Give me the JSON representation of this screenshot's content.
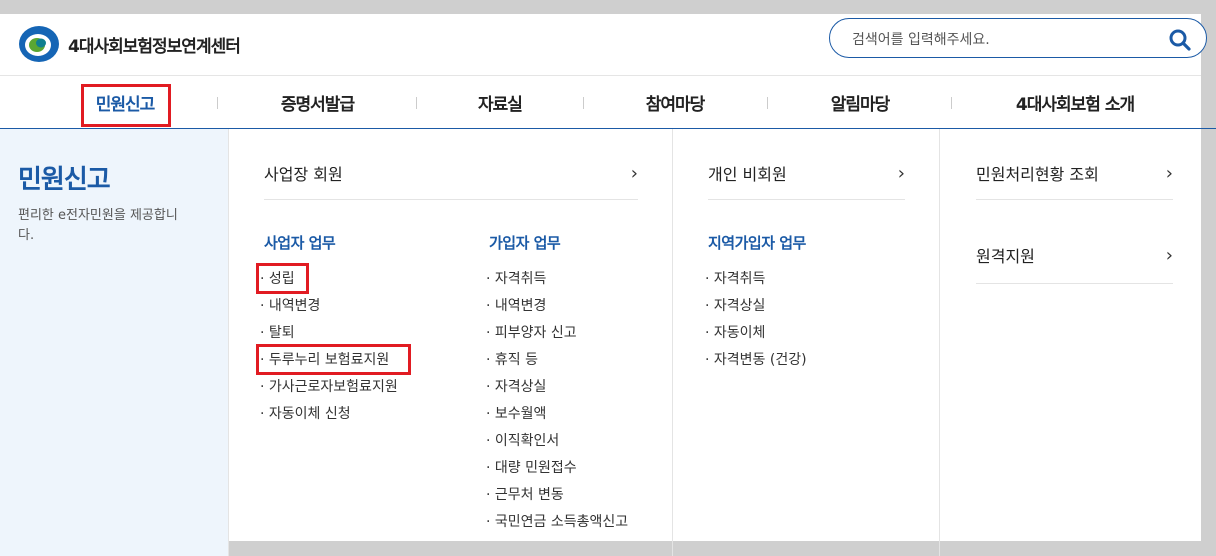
{
  "header": {
    "site_name": "4대사회보험정보연계센터",
    "search_placeholder": "검색어를 입력해주세요."
  },
  "gnb": [
    "민원신고",
    "증명서발급",
    "자료실",
    "참여마당",
    "알림마당",
    "4대사회보험 소개"
  ],
  "side": {
    "title": "민원신고",
    "desc": "편리한 e전자민원을 제공합니다."
  },
  "col1": {
    "link": "사업장 회원",
    "biz_title": "사업자 업무",
    "biz_items": [
      "· 성립",
      "· 내역변경",
      "· 탈퇴",
      "· 두루누리 보험료지원",
      "· 가사근로자보험료지원",
      "· 자동이체 신청"
    ],
    "sub_title": "가입자 업무",
    "sub_items": [
      "· 자격취득",
      "· 내역변경",
      "· 피부양자 신고",
      "· 휴직 등",
      "· 자격상실",
      "· 보수월액",
      "· 이직확인서",
      "· 대량 민원접수",
      "· 근무처 변동",
      "· 국민연금 소득총액신고"
    ]
  },
  "col2": {
    "link": "개인 비회원",
    "region_title": "지역가입자 업무",
    "region_items": [
      "· 자격취득",
      "· 자격상실",
      "· 자동이체",
      "· 자격변동 (건강)"
    ]
  },
  "col3": {
    "link1": "민원처리현황 조회",
    "link2": "원격지원"
  },
  "chevron": "›",
  "colors": {
    "accent": "#1b5aa6",
    "highlight": "#e11b22"
  }
}
